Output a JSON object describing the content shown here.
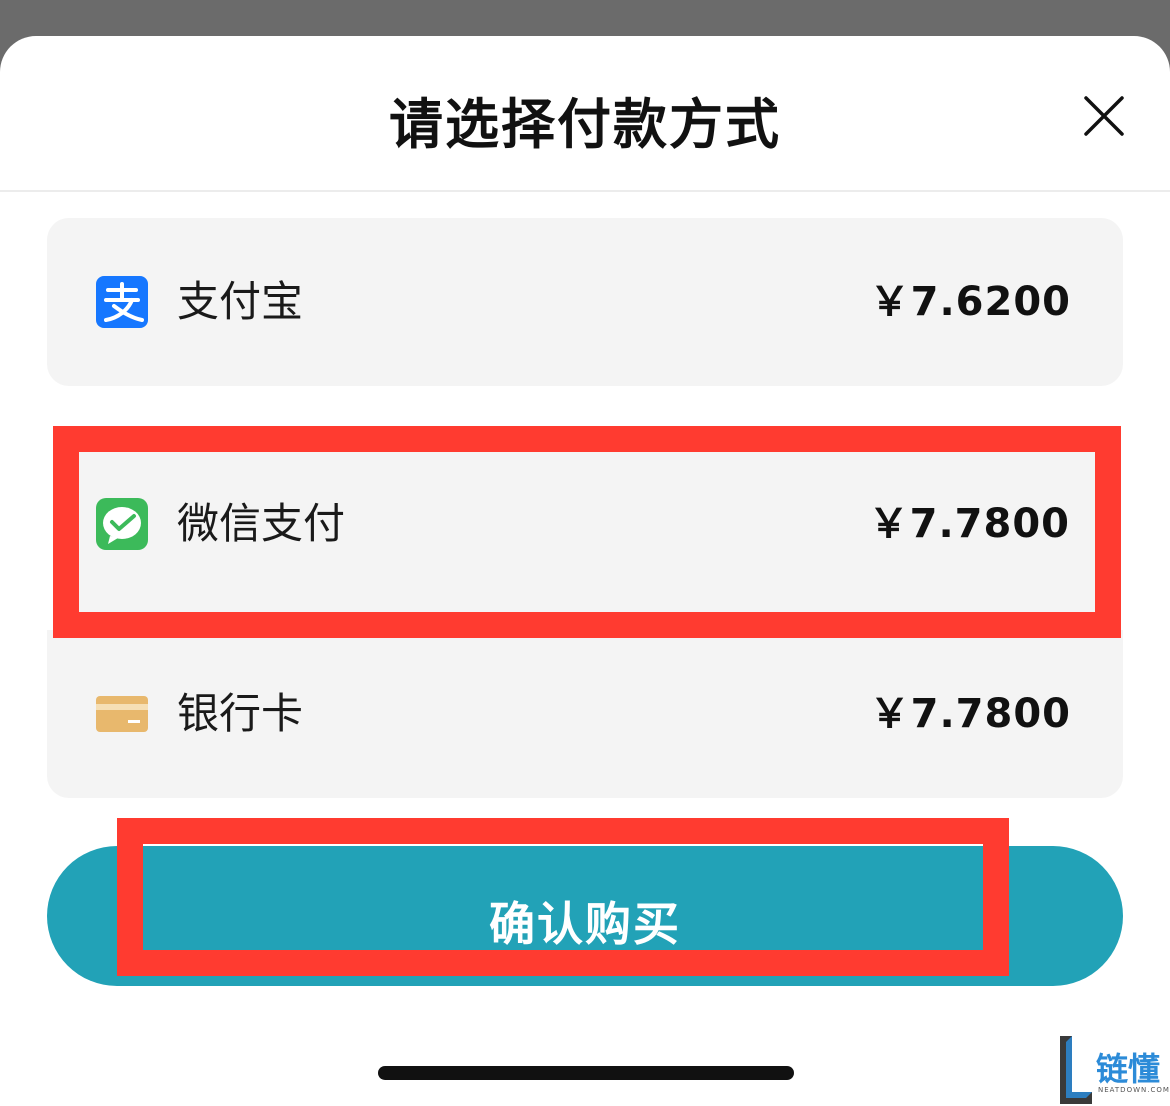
{
  "header": {
    "title": "请选择付款方式",
    "close_icon": "close-icon"
  },
  "payment_options": [
    {
      "name": "支付宝",
      "price": "￥7.6200",
      "icon": "alipay-icon",
      "icon_color": "#1677ff"
    },
    {
      "name": "微信支付",
      "price": "￥7.7800",
      "icon": "wechat-pay-icon",
      "icon_color": "#3cba5a"
    },
    {
      "name": "银行卡",
      "price": "￥7.7800",
      "icon": "bank-card-icon",
      "icon_color": "#e8b86d"
    }
  ],
  "confirm_button": {
    "label": "确认购买",
    "color": "#22a2b7"
  },
  "annotation_color": "#ff3b30",
  "watermark": {
    "text": "链懂",
    "sub": "NEATDOWN.COM"
  }
}
